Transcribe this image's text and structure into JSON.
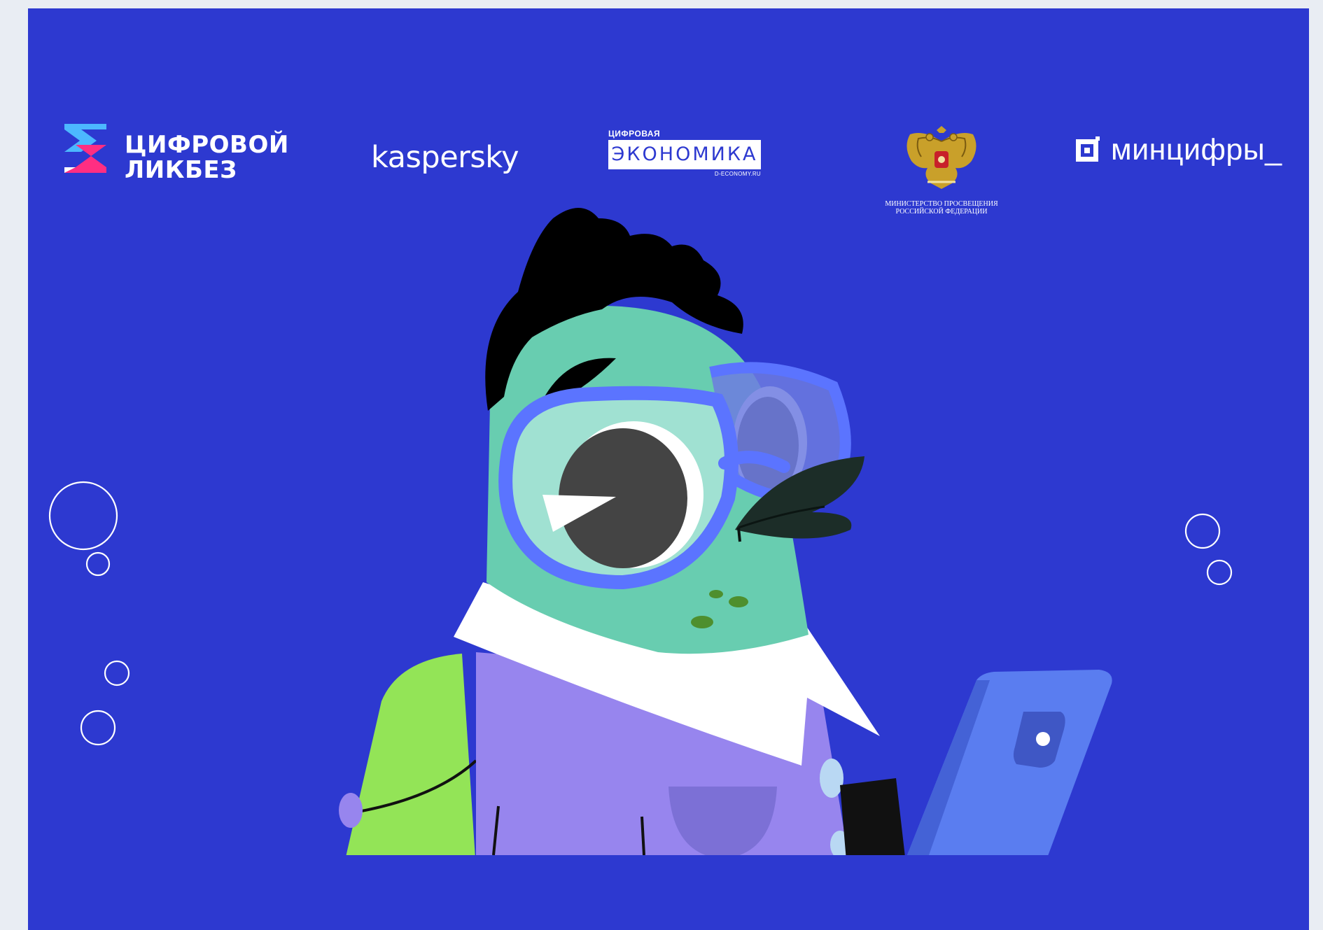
{
  "colors": {
    "page_bg": "#e9edf3",
    "banner_bg": "#2d39d0",
    "character_skin": "#68cdb0",
    "hair": "#000000",
    "glasses": "#5b74ff",
    "shirt": "#9785ee",
    "sleeve": "#93e457",
    "phone": "#5a7df0"
  },
  "logos": {
    "likbez": {
      "line1": "ЦИФРОВОЙ",
      "line2": "ЛИКБЕЗ",
      "icon": "chevron-arrows-icon"
    },
    "kaspersky": {
      "text": "kaspersky"
    },
    "economy": {
      "top": "ЦИФРОВАЯ",
      "word": "ЭКОНОМИКА",
      "url": "D-ECONOMY.RU"
    },
    "ministry": {
      "line1": "МИНИСТЕРСТВО ПРОСВЕЩЕНИЯ",
      "line2": "РОССИЙСКОЙ ФЕДЕРАЦИИ",
      "icon": "double-headed-eagle-emblem"
    },
    "mincifry": {
      "text": "минцифры_",
      "icon": "square-i-icon"
    }
  },
  "illustration": {
    "subject": "green bird character with glasses holding a phone",
    "decoration": "bubble-rings"
  }
}
